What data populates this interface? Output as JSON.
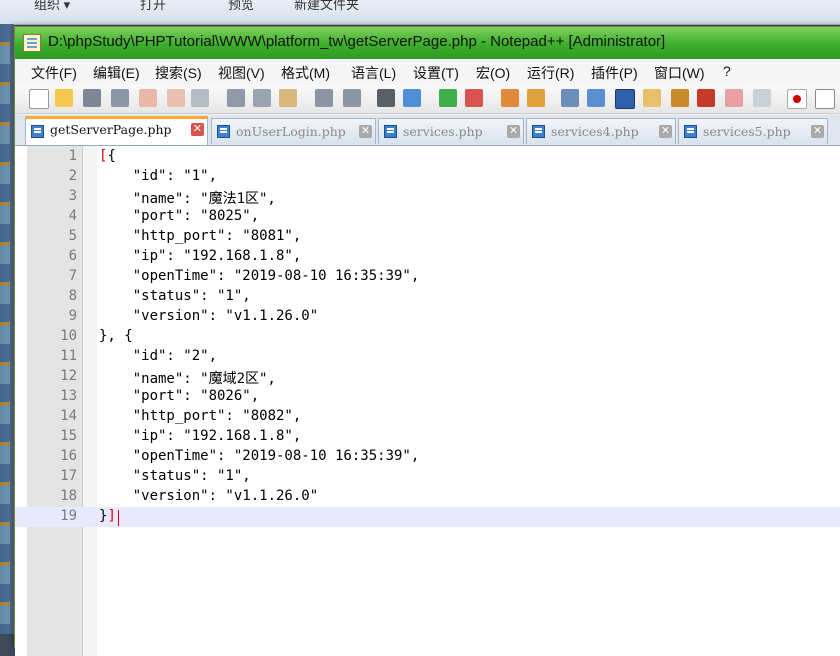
{
  "background": {
    "top_items": [
      "组织 ▾",
      "打开",
      "预览",
      "新建文件夹"
    ]
  },
  "window": {
    "title": "D:\\phpStudy\\PHPTutorial\\WWW\\platform_tw\\getServerPage.php - Notepad++ [Administrator]"
  },
  "menu": [
    "文件(F)",
    "编辑(E)",
    "搜索(S)",
    "视图(V)",
    "格式(M)",
    "语言(L)",
    "设置(T)",
    "宏(O)",
    "运行(R)",
    "插件(P)",
    "窗口(W)",
    "?"
  ],
  "toolbar_icons": [
    "new-file-icon",
    "open-file-icon",
    "save-icon",
    "save-all-icon",
    "close-icon",
    "close-all-icon",
    "print-icon",
    "cut-icon",
    "copy-icon",
    "paste-icon",
    "undo-icon",
    "redo-icon",
    "find-icon",
    "replace-icon",
    "zoom-in-icon",
    "zoom-out-icon",
    "sync-v-icon",
    "sync-h-icon",
    "wrap-icon",
    "show-all-chars-icon",
    "indent-guide-icon",
    "doc-map-icon",
    "function-list-icon",
    "folder-workspace-icon",
    "macro-record-icon",
    "monitor-icon",
    "record-icon",
    "stop-icon"
  ],
  "tabs": [
    {
      "label": "getServerPage.php",
      "active": true
    },
    {
      "label": "onUserLogin.php",
      "active": false
    },
    {
      "label": "services.php",
      "active": false
    },
    {
      "label": "services4.php",
      "active": false
    },
    {
      "label": "services5.php",
      "active": false
    }
  ],
  "editor": {
    "lines": [
      {
        "n": "1",
        "pre": "",
        "bracket": "[",
        "post": "{"
      },
      {
        "n": "2",
        "text": "    \"id\": \"1\","
      },
      {
        "n": "3",
        "text": "    \"name\": \"魔法1区\","
      },
      {
        "n": "4",
        "text": "    \"port\": \"8025\","
      },
      {
        "n": "5",
        "text": "    \"http_port\": \"8081\","
      },
      {
        "n": "6",
        "text": "    \"ip\": \"192.168.1.8\","
      },
      {
        "n": "7",
        "text": "    \"openTime\": \"2019-08-10 16:35:39\","
      },
      {
        "n": "8",
        "text": "    \"status\": \"1\","
      },
      {
        "n": "9",
        "text": "    \"version\": \"v1.1.26.0\""
      },
      {
        "n": "10",
        "text": "}, {"
      },
      {
        "n": "11",
        "text": "    \"id\": \"2\","
      },
      {
        "n": "12",
        "text": "    \"name\": \"魔域2区\","
      },
      {
        "n": "13",
        "text": "    \"port\": \"8026\","
      },
      {
        "n": "14",
        "text": "    \"http_port\": \"8082\","
      },
      {
        "n": "15",
        "text": "    \"ip\": \"192.168.1.8\","
      },
      {
        "n": "16",
        "text": "    \"openTime\": \"2019-08-10 16:35:39\","
      },
      {
        "n": "17",
        "text": "    \"status\": \"1\","
      },
      {
        "n": "18",
        "text": "    \"version\": \"v1.1.26.0\""
      },
      {
        "n": "19",
        "pre": "}",
        "bracket": "]",
        "post": "",
        "current": true
      }
    ]
  },
  "colors": {
    "title_bar": "#3cae2b",
    "active_tab_accent": "#f6a935",
    "brace_match": "#e00000",
    "current_line": "#e8e8ff"
  }
}
